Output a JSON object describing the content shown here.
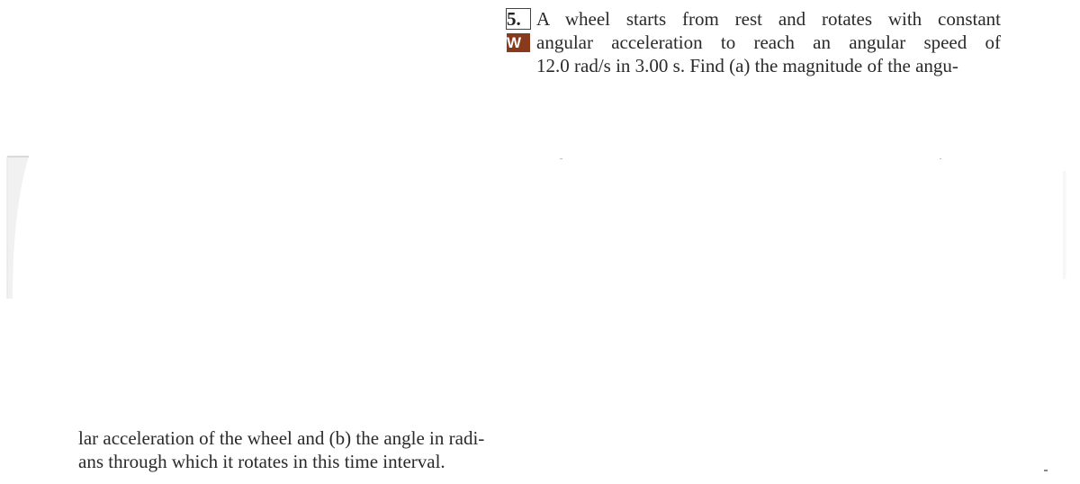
{
  "problem": {
    "number_label": "5.",
    "badge_label": "W",
    "badge_color": "#8a3a1c",
    "top_lines": [
      "A wheel starts from rest and rotates with constant",
      "angular acceleration to reach an angular speed of",
      "12.0 rad/s in 3.00 s. Find (a) the magnitude of the angu-"
    ],
    "bottom_lines": [
      "lar acceleration of the wheel and (b) the angle in radi-",
      "ans through which it rotates in this time interval."
    ]
  }
}
